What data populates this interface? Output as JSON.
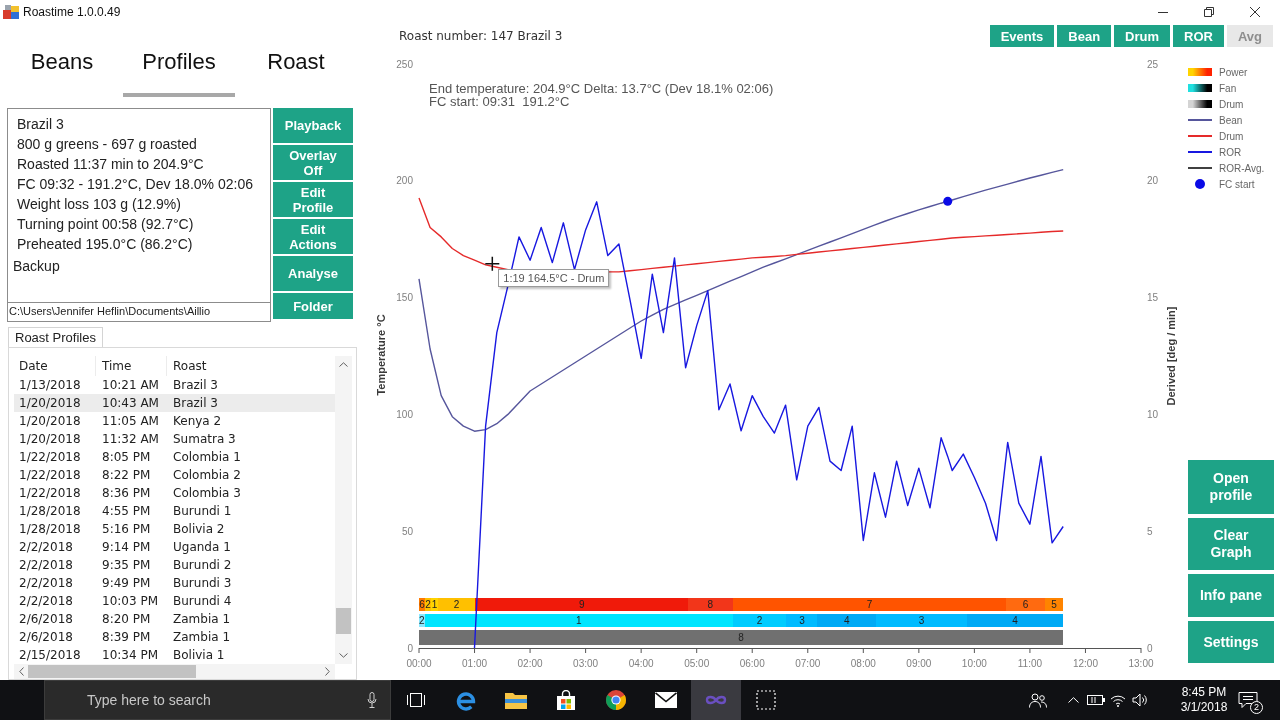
{
  "window": {
    "title": "Roastime 1.0.0.49"
  },
  "left_panel": {
    "tabs": [
      {
        "label": "Beans",
        "selected": false
      },
      {
        "label": "Profiles",
        "selected": true
      },
      {
        "label": "Roast",
        "selected": false
      }
    ],
    "profile_info": {
      "lines": [
        "Brazil 3",
        "800 g greens - 697 g roasted",
        "Roasted 11:37 min to 204.9°C",
        "FC 09:32 - 191.2°C, Dev 18.0% 02:06",
        "Weight loss 103 g (12.9%)",
        "Turning point 00:58 (92.7°C)",
        "Preheated 195.0°C (86.2°C)"
      ],
      "backup": "Backup",
      "folder_path": "C:\\Users\\Jennifer Heflin\\Documents\\Aillio"
    },
    "actions": [
      "Playback",
      "Overlay Off",
      "Edit Profile",
      "Edit Actions",
      "Analyse",
      "Folder"
    ],
    "roast_profiles": {
      "tab": "Roast Profiles",
      "columns": [
        "Date",
        "Time",
        "Roast"
      ],
      "rows": [
        {
          "cells": [
            "1/13/2018",
            "10:21 AM",
            "Brazil 3"
          ],
          "selected": false
        },
        {
          "cells": [
            "1/20/2018",
            "10:43 AM",
            "Brazil 3"
          ],
          "selected": true
        },
        {
          "cells": [
            "1/20/2018",
            "11:05 AM",
            "Kenya 2"
          ],
          "selected": false
        },
        {
          "cells": [
            "1/20/2018",
            "11:32 AM",
            "Sumatra 3"
          ],
          "selected": false
        },
        {
          "cells": [
            "1/22/2018",
            "8:05 PM",
            "Colombia 1"
          ],
          "selected": false
        },
        {
          "cells": [
            "1/22/2018",
            "8:22 PM",
            "Colombia 2"
          ],
          "selected": false
        },
        {
          "cells": [
            "1/22/2018",
            "8:36 PM",
            "Colombia 3"
          ],
          "selected": false
        },
        {
          "cells": [
            "1/28/2018",
            "4:55 PM",
            "Burundi 1"
          ],
          "selected": false
        },
        {
          "cells": [
            "1/28/2018",
            "5:16 PM",
            "Bolivia 2"
          ],
          "selected": false
        },
        {
          "cells": [
            "2/2/2018",
            "9:14 PM",
            "Uganda 1"
          ],
          "selected": false
        },
        {
          "cells": [
            "2/2/2018",
            "9:35 PM",
            "Burundi 2"
          ],
          "selected": false
        },
        {
          "cells": [
            "2/2/2018",
            "9:49 PM",
            "Burundi 3"
          ],
          "selected": false
        },
        {
          "cells": [
            "2/2/2018",
            "10:03 PM",
            "Burundi 4"
          ],
          "selected": false
        },
        {
          "cells": [
            "2/6/2018",
            "8:20 PM",
            "Zambia 1"
          ],
          "selected": false
        },
        {
          "cells": [
            "2/6/2018",
            "8:39 PM",
            "Zambia 1"
          ],
          "selected": false
        },
        {
          "cells": [
            "2/15/2018",
            "10:34 PM",
            "Bolivia 1"
          ],
          "selected": false
        }
      ]
    }
  },
  "graph": {
    "roast_number": "Roast number: 147 Brazil 3",
    "toggles": [
      {
        "label": "Events",
        "on": true
      },
      {
        "label": "Bean",
        "on": true
      },
      {
        "label": "Drum",
        "on": true
      },
      {
        "label": "ROR",
        "on": true
      },
      {
        "label": "Avg",
        "on": false
      }
    ],
    "summary": [
      "End temperature: 204.9°C Delta: 13.7°C (Dev 18.1% 02:06)",
      "FC start: 09:31  191.2°C"
    ],
    "legend": [
      {
        "kind": "gradient",
        "label": "Power",
        "gradient": [
          {
            "color": "#ffd400"
          },
          {
            "color": "#ff2200"
          }
        ]
      },
      {
        "kind": "gradient",
        "label": "Fan",
        "gradient": [
          {
            "color": "#20e0e0"
          },
          {
            "color": "#000000"
          }
        ]
      },
      {
        "kind": "gradient",
        "label": "Drum",
        "gradient": [
          {
            "color": "#d4d4d4"
          },
          {
            "color": "#000000"
          }
        ]
      },
      {
        "kind": "series"
      },
      {
        "kind": "series"
      },
      {
        "kind": "series"
      },
      {
        "kind": "line",
        "label": "ROR-Avg.",
        "color": "#404040"
      },
      {
        "kind": "series"
      }
    ],
    "setting_bars": [
      {
        "segments": [
          {
            "label": "6",
            "color": "#ff7a00"
          },
          {
            "label": "2",
            "color": "#ffc000"
          },
          {
            "label": "1",
            "color": "#ffd400"
          },
          {
            "label": "2",
            "color": "#ffc000"
          },
          {
            "label": "9",
            "color": "#f01a0a"
          },
          {
            "label": "8",
            "color": "#f2361a"
          },
          {
            "label": "7",
            "color": "#ff5400"
          },
          {
            "label": "6",
            "color": "#ff6a10"
          },
          {
            "label": "5",
            "color": "#ff8400"
          }
        ]
      },
      {
        "segments": [
          {
            "label": "2",
            "color": "#8ae8ff"
          },
          {
            "label": "1",
            "color": "#00e5ff"
          },
          {
            "label": "2",
            "color": "#00ccff"
          },
          {
            "label": "3",
            "color": "#00bbff"
          },
          {
            "label": "4",
            "color": "#00aaf5"
          },
          {
            "label": "3",
            "color": "#00bbff"
          },
          {
            "label": "4",
            "color": "#00aaf5"
          }
        ]
      },
      {
        "segments": [
          {
            "label": "8",
            "color": "#707070"
          }
        ]
      }
    ],
    "chart_data": {
      "type": "line",
      "ylabel": "Temperature °C",
      "y2label": "Derived [deg / min]",
      "xlim": [
        0,
        13
      ],
      "ylim": [
        0,
        250
      ],
      "y2lim": [
        0,
        25
      ],
      "xticks": [
        {
          "value": 0,
          "label": "00:00"
        },
        {
          "value": 1,
          "label": "01:00"
        },
        {
          "value": 2,
          "label": "02:00"
        },
        {
          "value": 3,
          "label": "03:00"
        },
        {
          "value": 4,
          "label": "04:00"
        },
        {
          "value": 5,
          "label": "05:00"
        },
        {
          "value": 6,
          "label": "06:00"
        },
        {
          "value": 7,
          "label": "07:00"
        },
        {
          "value": 8,
          "label": "08:00"
        },
        {
          "value": 9,
          "label": "09:00"
        },
        {
          "value": 10,
          "label": "10:00"
        },
        {
          "value": 11,
          "label": "11:00"
        },
        {
          "value": 12,
          "label": "12:00"
        },
        {
          "value": 13,
          "label": "13:00"
        }
      ],
      "yticks": [
        0,
        50,
        100,
        150,
        200,
        250
      ],
      "y2ticks": [
        0,
        5,
        10,
        15,
        20,
        25
      ],
      "x": [
        0,
        0.2,
        0.4,
        0.6,
        0.8,
        1,
        1.2,
        1.4,
        1.6,
        1.8,
        2,
        2.2,
        2.4,
        2.6,
        2.8,
        3,
        3.2,
        3.4,
        3.6,
        3.8,
        4,
        4.2,
        4.4,
        4.6,
        4.8,
        5,
        5.2,
        5.4,
        5.6,
        5.8,
        6,
        6.2,
        6.4,
        6.6,
        6.8,
        7,
        7.2,
        7.4,
        7.6,
        7.8,
        8,
        8.2,
        8.4,
        8.6,
        8.8,
        9,
        9.2,
        9.4,
        9.52,
        9.6,
        9.8,
        10,
        10.2,
        10.4,
        10.6,
        10.8,
        11,
        11.2,
        11.4,
        11.6
      ],
      "series": [
        {
          "name": "Bean",
          "color": "#56569c",
          "values": [
            158,
            128,
            108,
            99,
            95,
            92.8,
            93.5,
            96,
            100,
            105,
            110,
            113,
            116,
            119,
            122,
            125,
            128,
            131,
            134,
            137,
            140,
            142.5,
            145,
            147,
            149,
            151,
            153,
            155,
            157,
            159,
            161,
            163,
            164.8,
            166.6,
            168.4,
            170.2,
            172,
            173.8,
            175.6,
            177.4,
            179.2,
            181,
            182.8,
            184.4,
            186,
            187.6,
            189,
            190.4,
            191.2,
            191.8,
            193.2,
            194.6,
            196,
            197.3,
            198.6,
            199.9,
            201.2,
            202.4,
            203.6,
            204.8
          ]
        },
        {
          "name": "Drum",
          "color": "#e52a2a",
          "values": [
            192.6,
            180,
            176,
            171,
            168,
            166,
            164,
            163,
            162,
            null,
            null,
            null,
            null,
            null,
            null,
            null,
            null,
            161,
            161,
            161.5,
            162,
            162.5,
            163,
            163.5,
            164,
            164.5,
            165,
            165.5,
            166,
            166.5,
            167,
            167.3,
            167.6,
            168,
            168.5,
            169,
            169.5,
            170,
            170.5,
            171,
            171.5,
            172,
            172.5,
            173,
            173.5,
            174,
            174.5,
            175,
            175.3,
            175.5,
            175.8,
            176.1,
            176.4,
            176.7,
            177,
            177.3,
            177.6,
            178,
            178.3,
            178.5
          ]
        },
        {
          "name": "ROR",
          "color": "#1818e0",
          "axis": "y2",
          "values": [
            null,
            null,
            null,
            null,
            null,
            0,
            9.5,
            13.5,
            15.5,
            17.6,
            16.6,
            18,
            16.5,
            18.2,
            16.2,
            17.9,
            19.1,
            16.8,
            17.3,
            14.9,
            12.4,
            16,
            13.5,
            16.7,
            12,
            13.8,
            15.3,
            10.2,
            11.3,
            9.3,
            10.8,
            9.9,
            9.2,
            10.4,
            7.2,
            9.5,
            10.3,
            8,
            7.6,
            9.5,
            4.6,
            7.5,
            5.6,
            8,
            6.1,
            7.7,
            6,
            9,
            8.2,
            7.6,
            8.3,
            7.3,
            6.2,
            4.6,
            8.8,
            6.2,
            5.3,
            8.2,
            4.5,
            5.2
          ]
        },
        {
          "name": "FC start",
          "color": "#0a0ae6",
          "marker": "circle",
          "values": [
            null,
            null,
            null,
            null,
            null,
            null,
            null,
            null,
            null,
            null,
            null,
            null,
            null,
            null,
            null,
            null,
            null,
            null,
            null,
            null,
            null,
            null,
            null,
            null,
            null,
            null,
            null,
            null,
            null,
            null,
            null,
            null,
            null,
            null,
            null,
            null,
            null,
            null,
            null,
            null,
            null,
            null,
            null,
            null,
            null,
            null,
            null,
            null,
            191.2,
            null,
            null,
            null,
            null,
            null,
            null,
            null,
            null,
            null,
            null,
            null
          ]
        }
      ],
      "annotations": [
        {
          "x": 1.32,
          "y": 164.5,
          "text": "1:19 164.5°C - Drum"
        }
      ]
    }
  },
  "side_buttons": [
    "Open profile",
    "Clear Graph",
    "Info pane",
    "Settings"
  ],
  "taskbar": {
    "search": {
      "placeholder": "Type here to search"
    },
    "apps": [
      {
        "kind": "task_view",
        "selected": false
      },
      {
        "kind": "browser",
        "selected": false
      },
      {
        "kind": "folder",
        "selected": false
      },
      {
        "kind": "store",
        "selected": false
      },
      {
        "kind": "round_browser",
        "selected": false
      },
      {
        "kind": "mail",
        "selected": false
      },
      {
        "kind": "loop",
        "selected": true
      },
      {
        "kind": "snip",
        "selected": false
      }
    ],
    "clock": {
      "time": "8:45 PM",
      "date": "3/1/2018"
    },
    "notification_count": "2"
  }
}
